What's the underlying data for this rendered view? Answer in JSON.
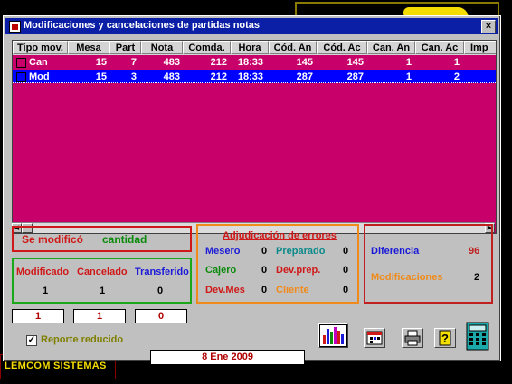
{
  "footer": {
    "company": "LEMCOM SISTEMAS"
  },
  "window": {
    "title": "Modificaciones y cancelaciones de partidas notas",
    "close_label": "×"
  },
  "grid": {
    "columns": [
      "Tipo mov.",
      "Mesa",
      "Part",
      "Nota",
      "Comda.",
      "Hora",
      "Cód. An",
      "Cód. Ac",
      "Can. An",
      "Can. Ac",
      "Imp"
    ],
    "rows": [
      {
        "tipo": "Can",
        "mesa": "15",
        "part": "7",
        "nota": "483",
        "comda": "212",
        "hora": "18:33",
        "cod_an": "145",
        "cod_ac": "145",
        "can_an": "1",
        "can_ac": "1"
      },
      {
        "tipo": "Mod",
        "mesa": "15",
        "part": "3",
        "nota": "483",
        "comda": "212",
        "hora": "18:33",
        "cod_an": "287",
        "cod_ac": "287",
        "can_an": "1",
        "can_ac": "2"
      }
    ]
  },
  "status": {
    "prefix": "Se modificó",
    "value": "cantidad"
  },
  "counts": {
    "modificado_label": "Modificado",
    "cancelado_label": "Cancelado",
    "transferido_label": "Transferido",
    "modificado": "1",
    "cancelado": "1",
    "transferido": "0"
  },
  "totals": {
    "box1": "1",
    "box2": "1",
    "box3": "0"
  },
  "errores": {
    "title": "Adjudicación de errores",
    "mesero_label": "Mesero",
    "mesero": "0",
    "preparado_label": "Preparado",
    "preparado": "0",
    "cajero_label": "Cajero",
    "cajero": "0",
    "devprep_label": "Dev.prep.",
    "devprep": "0",
    "devmes_label": "Dev.Mes",
    "devmes": "0",
    "cliente_label": "Cliente",
    "cliente": "0"
  },
  "diferencia": {
    "label": "Diferencia",
    "value": "96",
    "mod_label": "Modificaciones",
    "mod_value": "2"
  },
  "reporte": {
    "label": "Reporte reducido",
    "checked": "✓"
  },
  "date": "8 Ene 2009",
  "colors": {
    "grid_bg": "#c8006a",
    "selected": "#0000ff",
    "title_bar": "#0a1fa6"
  }
}
